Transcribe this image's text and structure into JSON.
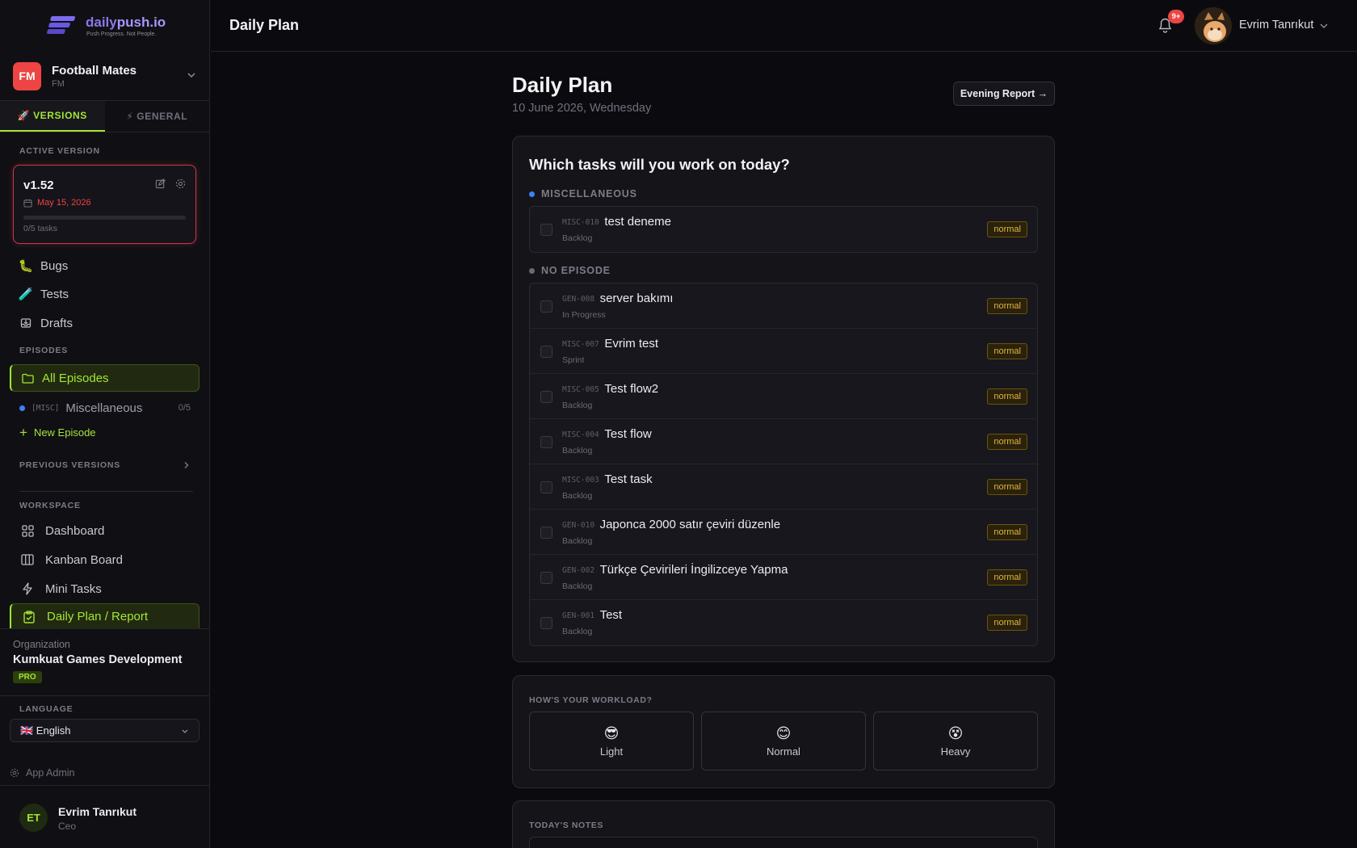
{
  "brand": {
    "name_a": "daily",
    "name_b": "push.io",
    "tagline": "Push Progress. Not People."
  },
  "project": {
    "initials": "FM",
    "name": "Football Mates",
    "code": "FM"
  },
  "tabs": [
    {
      "label": "🚀 VERSIONS"
    },
    {
      "label": "⚡ GENERAL"
    }
  ],
  "active_version": {
    "section": "ACTIVE VERSION",
    "name": "v1.52",
    "date": "May 15, 2026",
    "progress": 0,
    "tasks": "0/5 tasks"
  },
  "nav_top": [
    {
      "label": "Bugs",
      "icon": "bug-icon"
    },
    {
      "label": "Tests",
      "icon": "test-tube-icon"
    },
    {
      "label": "Drafts",
      "icon": "inbox-icon"
    }
  ],
  "episodes": {
    "section": "EPISODES",
    "all": "All Episodes",
    "items": [
      {
        "code": "[MISC]",
        "name": "Miscellaneous",
        "count": "0/5"
      }
    ],
    "new": "New Episode",
    "previous": "PREVIOUS VERSIONS"
  },
  "workspace": {
    "section": "WORKSPACE",
    "items": [
      {
        "label": "Dashboard",
        "icon": "grid-icon"
      },
      {
        "label": "Kanban Board",
        "icon": "columns-icon"
      },
      {
        "label": "Mini Tasks",
        "icon": "bolt-icon"
      },
      {
        "label": "Daily Plan / Report",
        "icon": "clipboard-check-icon"
      }
    ]
  },
  "org": {
    "label": "Organization",
    "name": "Kumkuat Games Development",
    "plan": "PRO"
  },
  "language": {
    "section": "LANGUAGE",
    "value": "🇬🇧 English"
  },
  "app_admin": "App Admin",
  "user": {
    "initials": "ET",
    "name": "Evrim Tanrıkut",
    "role": "Ceo"
  },
  "topbar": {
    "title": "Daily Plan",
    "notifications": "9+",
    "user_name": "Evrim Tanrıkut"
  },
  "page": {
    "title": "Daily Plan",
    "date": "10 June 2026, Wednesday",
    "evening_button": "Evening Report →",
    "question": "Which tasks will you work on today?",
    "groups": [
      {
        "name": "MISCELLANEOUS",
        "color": "#3b82f6",
        "tasks": [
          {
            "code": "MISC-010",
            "title": "test deneme",
            "status": "Backlog",
            "priority": "normal"
          }
        ]
      },
      {
        "name": "NO EPISODE",
        "color": "#6b6b78",
        "tasks": [
          {
            "code": "GEN-008",
            "title": "server bakımı",
            "status": "In Progress",
            "priority": "normal"
          },
          {
            "code": "MISC-007",
            "title": "Evrim test",
            "status": "Sprint",
            "priority": "normal"
          },
          {
            "code": "MISC-005",
            "title": "Test flow2",
            "status": "Backlog",
            "priority": "normal"
          },
          {
            "code": "MISC-004",
            "title": "Test flow",
            "status": "Backlog",
            "priority": "normal"
          },
          {
            "code": "MISC-003",
            "title": "Test task",
            "status": "Backlog",
            "priority": "normal"
          },
          {
            "code": "GEN-010",
            "title": "Japonca 2000 satır çeviri düzenle",
            "status": "Backlog",
            "priority": "normal"
          },
          {
            "code": "GEN-002",
            "title": "Türkçe Çevirileri İngilizceye Yapma",
            "status": "Backlog",
            "priority": "normal"
          },
          {
            "code": "GEN-001",
            "title": "Test",
            "status": "Backlog",
            "priority": "normal"
          }
        ]
      }
    ],
    "workload": {
      "label": "HOW'S YOUR WORKLOAD?",
      "options": [
        {
          "emoji": "😎",
          "label": "Light"
        },
        {
          "emoji": "😊",
          "label": "Normal"
        },
        {
          "emoji": "😵",
          "label": "Heavy"
        }
      ]
    },
    "notes_label": "TODAY'S NOTES"
  }
}
